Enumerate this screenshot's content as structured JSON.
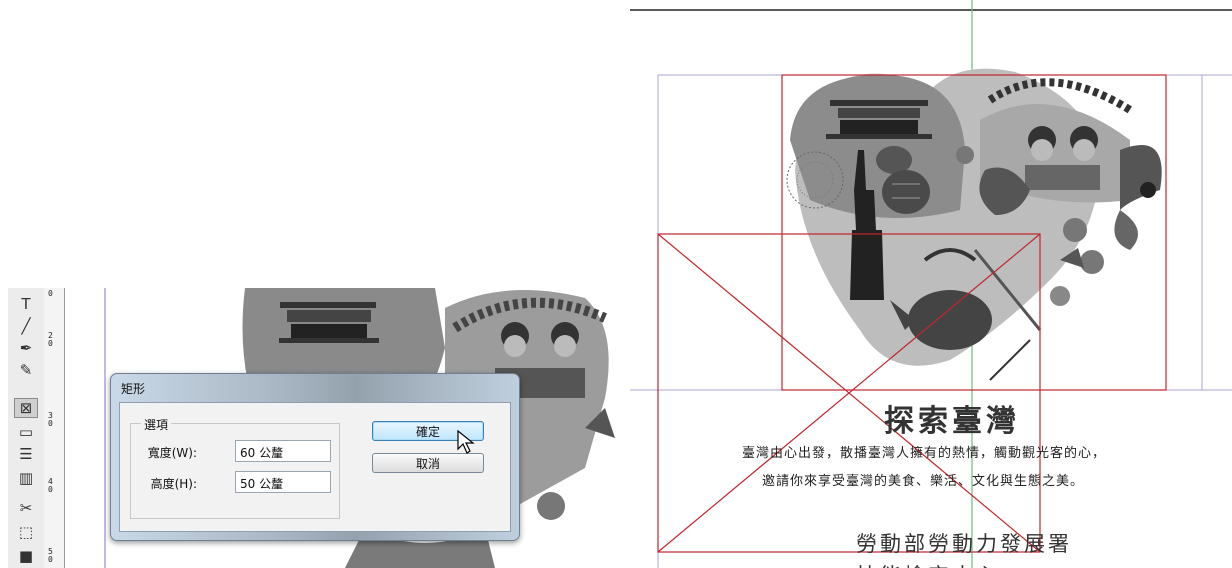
{
  "toolbar": {
    "tools": [
      {
        "icon": "type-tool-icon",
        "glyph": "T"
      },
      {
        "icon": "line-tool-icon",
        "glyph": "╱"
      },
      {
        "icon": "pen-tool-icon",
        "glyph": "✒"
      },
      {
        "icon": "pencil-tool-icon",
        "glyph": "✎"
      },
      {
        "icon": "rectangle-frame-tool-icon",
        "glyph": "⊠"
      },
      {
        "icon": "rectangle-tool-icon",
        "glyph": "▭"
      },
      {
        "icon": "horizontal-grid-tool-icon",
        "glyph": "☰"
      },
      {
        "icon": "vertical-grid-tool-icon",
        "glyph": "▥"
      },
      {
        "icon": "scissors-tool-icon",
        "glyph": "✂"
      },
      {
        "icon": "free-transform-tool-icon",
        "glyph": "⬚"
      },
      {
        "icon": "gradient-tool-icon",
        "glyph": "■"
      }
    ],
    "selected_index": 4
  },
  "ruler": {
    "marks": [
      "0",
      "2\n0",
      "3\n0",
      "4\n0",
      "5\n0"
    ]
  },
  "dialog": {
    "title": "矩形",
    "group_label": "選項",
    "width_label": "寬度(W):",
    "width_value": "60 公釐",
    "height_label": "高度(H):",
    "height_value": "50 公釐",
    "ok_label": "確定",
    "cancel_label": "取消"
  },
  "poster": {
    "title": "探索臺灣",
    "line1": "臺灣由心出發，散播臺灣人擁有的熱情，觸動觀光客的心，",
    "line2": "邀請你來享受臺灣的美食、樂活、文化與生態之美。",
    "org": "勞動部勞動力發展署",
    "sub": "技能檢定中心"
  },
  "colors": {
    "guide_red": "#c0262d",
    "guide_green": "#6fbf7a",
    "guide_purple": "#7b74c9"
  }
}
